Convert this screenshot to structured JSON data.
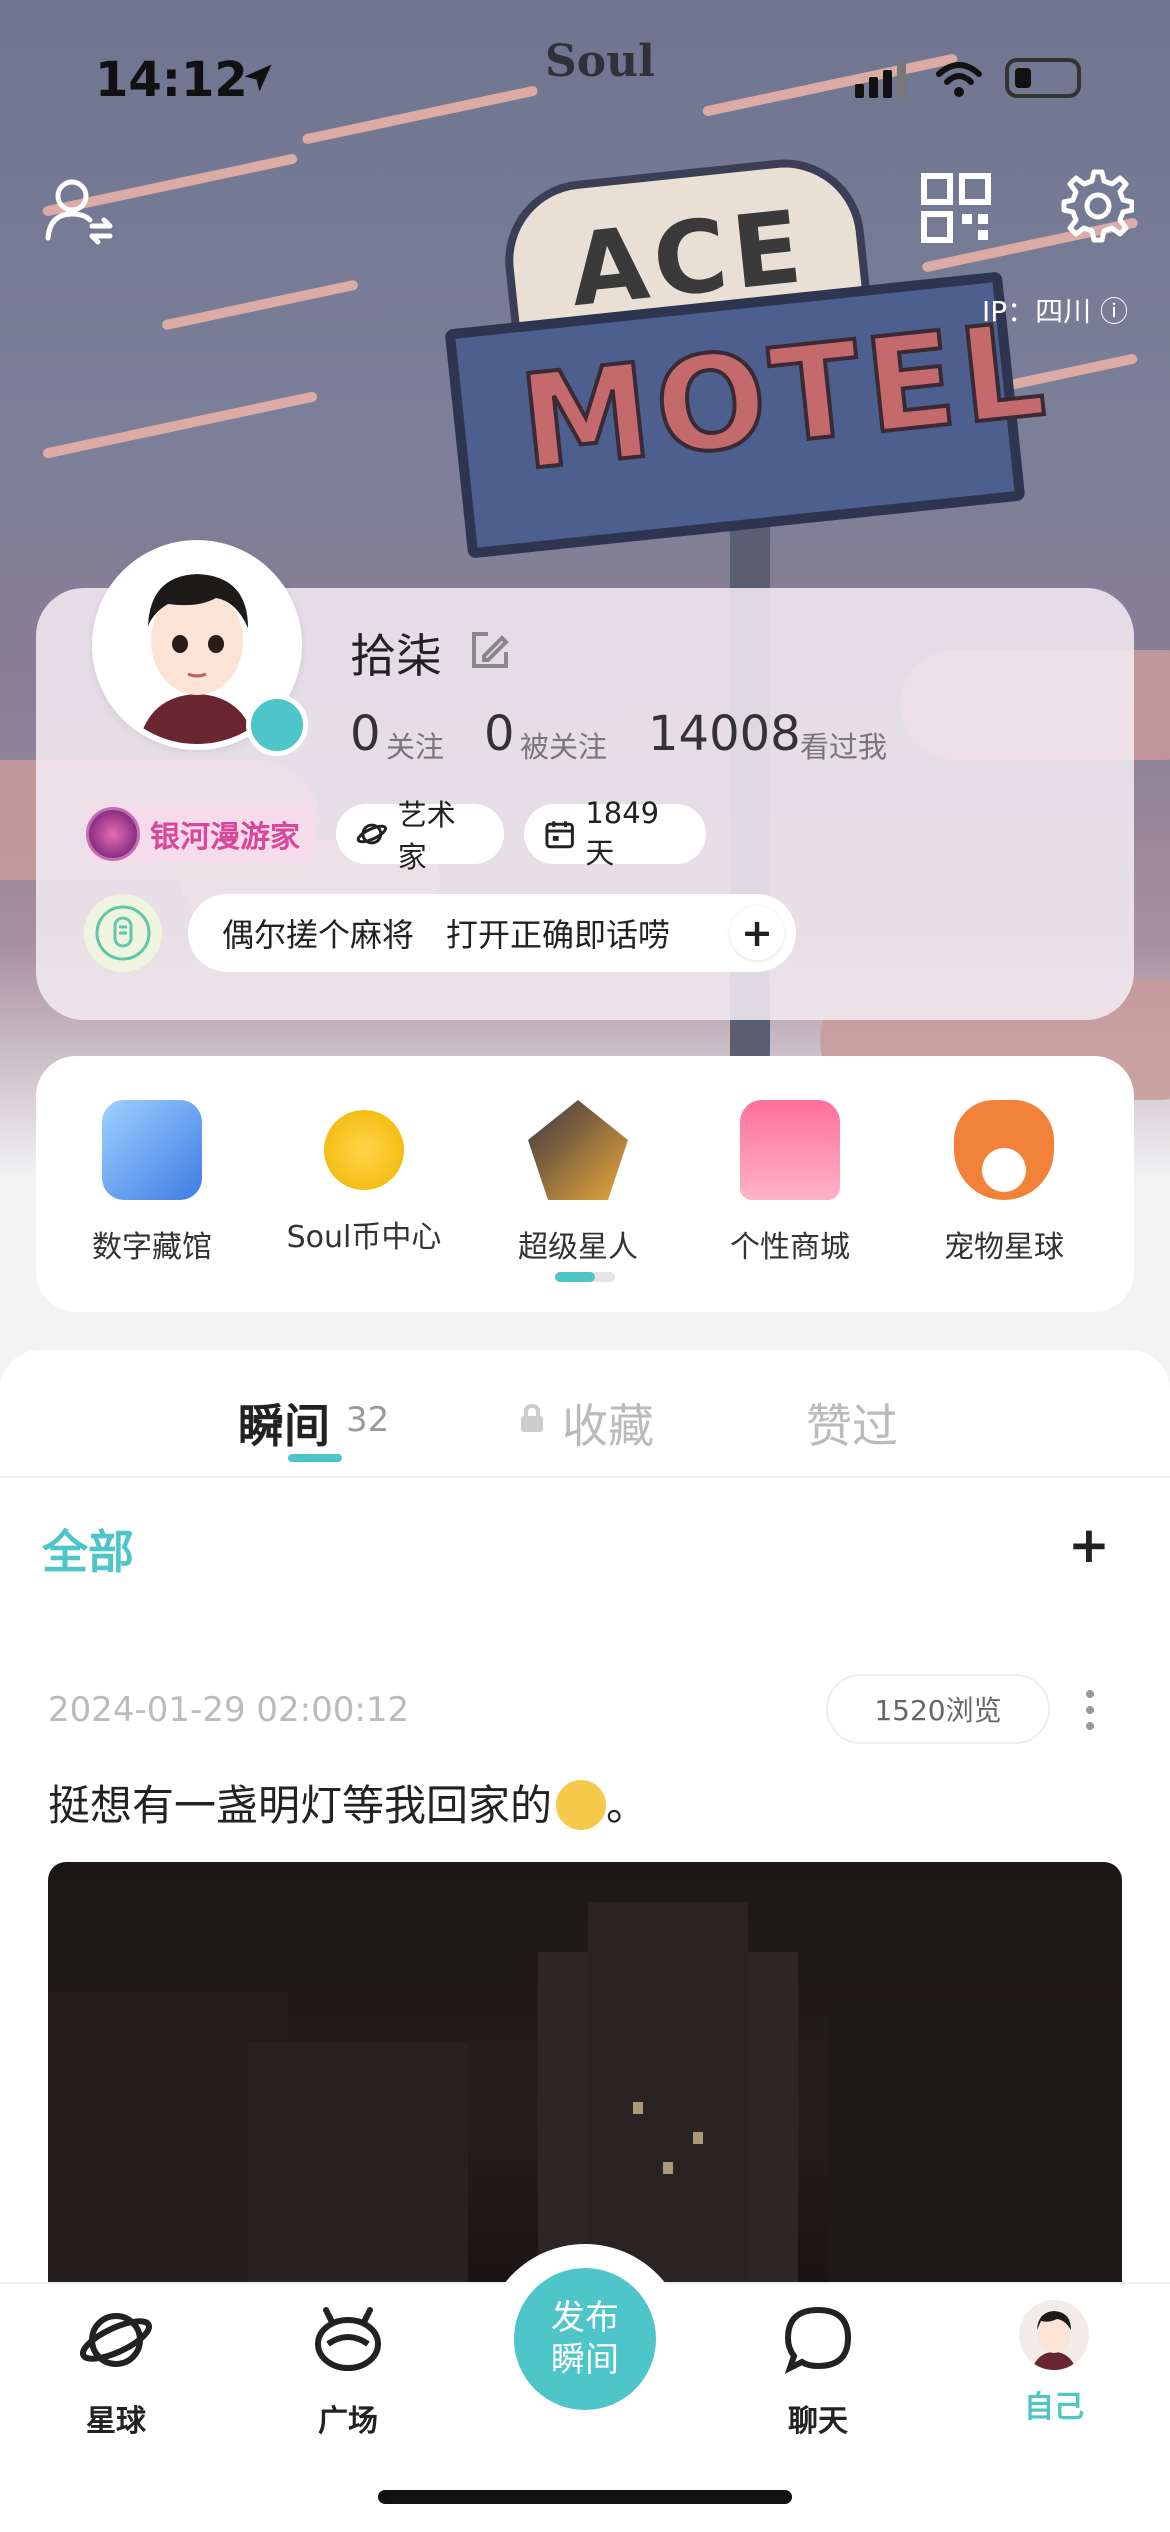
{
  "status_bar": {
    "time": "14:12",
    "brand": "Soul"
  },
  "header": {
    "ip_label": "IP：四川 ⓘ",
    "sign_top": "ACE",
    "sign_bottom": "MOTEL"
  },
  "profile": {
    "name": "拾柒",
    "following_count": "0",
    "following_label": "关注",
    "followers_count": "0",
    "followers_label": "被关注",
    "visitors_count": "14008",
    "visitors_label": "看过我",
    "badges": {
      "galaxy": "银河漫游家",
      "artist": "艺术家",
      "days": "1849天"
    },
    "bio": "偶尔搓个麻将　打开正确即话唠",
    "bio_add": "+"
  },
  "features": [
    {
      "label": "数字藏馆",
      "icon": "museum-icon"
    },
    {
      "label": "Soul币中心",
      "icon": "soul-coin-icon"
    },
    {
      "label": "超级星人",
      "icon": "super-star-icon"
    },
    {
      "label": "个性商城",
      "icon": "shop-icon"
    },
    {
      "label": "宠物星球",
      "icon": "pet-icon"
    }
  ],
  "tabs": {
    "moments": "瞬间",
    "moments_count": "32",
    "favorites": "收藏",
    "liked": "赞过"
  },
  "filter": {
    "all": "全部",
    "add": "+"
  },
  "post": {
    "time": "2024-01-29 02:00:12",
    "views": "1520浏览",
    "text": "挺想有一盏明灯等我回家的",
    "text_suffix": "。"
  },
  "nav": {
    "planet": "星球",
    "square": "广场",
    "publish": "发布\n瞬间",
    "chat": "聊天",
    "me": "自己"
  },
  "colors": {
    "accent": "#4ec5c9",
    "galaxy_pink": "#d8479a"
  }
}
